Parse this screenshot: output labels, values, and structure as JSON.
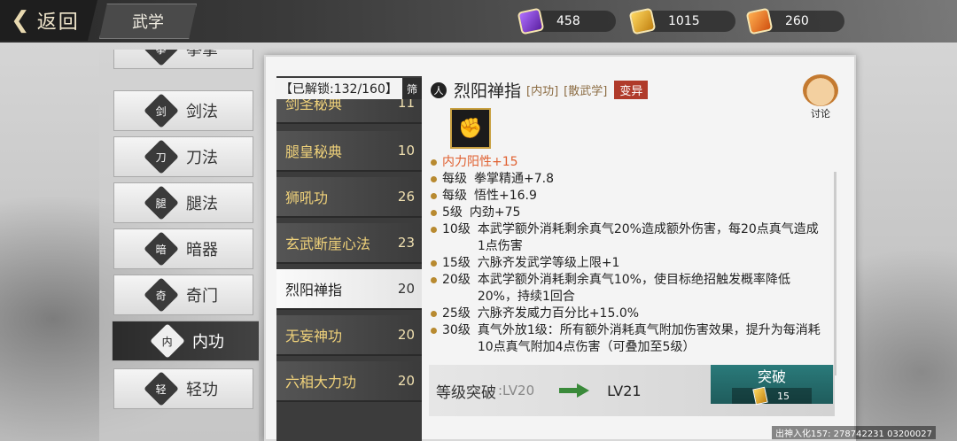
{
  "header": {
    "back_label": "返回",
    "section_title": "武学"
  },
  "resources": [
    {
      "icon": "purple-scroll-icon",
      "color": "#8a3ad0",
      "value": "458"
    },
    {
      "icon": "gold-token-icon",
      "color": "#d8a020",
      "value": "1015"
    },
    {
      "icon": "fire-scroll-icon",
      "color": "#e06a20",
      "value": "260"
    }
  ],
  "sidenav": [
    {
      "label": "拳掌",
      "icon": "fist-icon",
      "glyph": "拳"
    },
    {
      "label": "剑法",
      "icon": "sword-icon",
      "glyph": "剑"
    },
    {
      "label": "刀法",
      "icon": "blade-icon",
      "glyph": "刀"
    },
    {
      "label": "腿法",
      "icon": "kick-icon",
      "glyph": "腿"
    },
    {
      "label": "暗器",
      "icon": "shuriken-icon",
      "glyph": "暗"
    },
    {
      "label": "奇门",
      "icon": "odd-weapon-icon",
      "glyph": "奇"
    },
    {
      "label": "内功",
      "icon": "meditation-icon",
      "glyph": "内"
    },
    {
      "label": "轻功",
      "icon": "flight-icon",
      "glyph": "轻"
    }
  ],
  "list": {
    "header": "【已解锁:132/160】",
    "filter_label": "筛",
    "rows": [
      {
        "name": "剑圣秘典",
        "level": "11"
      },
      {
        "name": "腿皇秘典",
        "level": "10"
      },
      {
        "name": "狮吼功",
        "level": "26"
      },
      {
        "name": "玄武断崖心法",
        "level": "23"
      },
      {
        "name": "烈阳禅指",
        "level": "20"
      },
      {
        "name": "无妄神功",
        "level": "20"
      },
      {
        "name": "六相大力功",
        "level": "20"
      }
    ]
  },
  "detail": {
    "symbol": "人",
    "name": "烈阳禅指",
    "tag_type": "[内功]",
    "tag_school": "[散武学]",
    "tag_mutation": "变异",
    "discuss_label": "讨论",
    "effects": [
      {
        "level": "",
        "text": "内力阳性+15",
        "highlight": true
      },
      {
        "level": "每级",
        "text": "拳掌精通+7.8"
      },
      {
        "level": "每级",
        "text": "悟性+16.9"
      },
      {
        "level": "5级",
        "text": "内劲+75"
      },
      {
        "level": "10级",
        "text": "本武学额外消耗剩余真气20%造成额外伤害，每20点真气造成1点伤害"
      },
      {
        "level": "15级",
        "text": "六脉齐发武学等级上限+1"
      },
      {
        "level": "20级",
        "text": "本武学额外消耗剩余真气10%，使目标绝招触发概率降低20%，持续1回合"
      },
      {
        "level": "25级",
        "text": "六脉齐发威力百分比+15.0%"
      },
      {
        "level": "30级",
        "text": "真气外放1级：所有额外消耗真气附加伤害效果，提升为每消耗10点真气附加4点伤害（可叠加至5级）"
      }
    ],
    "breakthrough": {
      "label": "等级突破",
      "from": ":LV20",
      "to": "LV21",
      "button": "突破",
      "cost": "15"
    }
  },
  "footer": "出神入化157: 278742231  03200027"
}
